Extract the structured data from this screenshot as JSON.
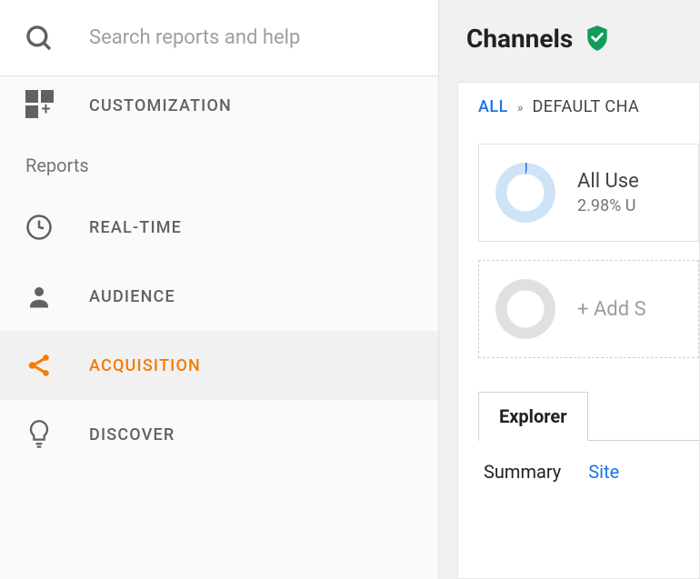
{
  "sidebar": {
    "search_placeholder": "Search reports and help",
    "customization_label": "CUSTOMIZATION",
    "section_header": "Reports",
    "items": [
      {
        "label": "REAL-TIME"
      },
      {
        "label": "AUDIENCE"
      },
      {
        "label": "ACQUISITION"
      },
      {
        "label": "DISCOVER"
      }
    ]
  },
  "main": {
    "title": "Channels",
    "breadcrumb": {
      "all": "ALL",
      "rest": "DEFAULT CHA"
    },
    "segment": {
      "title": "All Use",
      "subtitle": "2.98% U"
    },
    "add_segment": "+ Add S",
    "tab": "Explorer",
    "subtabs": {
      "summary": "Summary",
      "site": "Site "
    }
  }
}
